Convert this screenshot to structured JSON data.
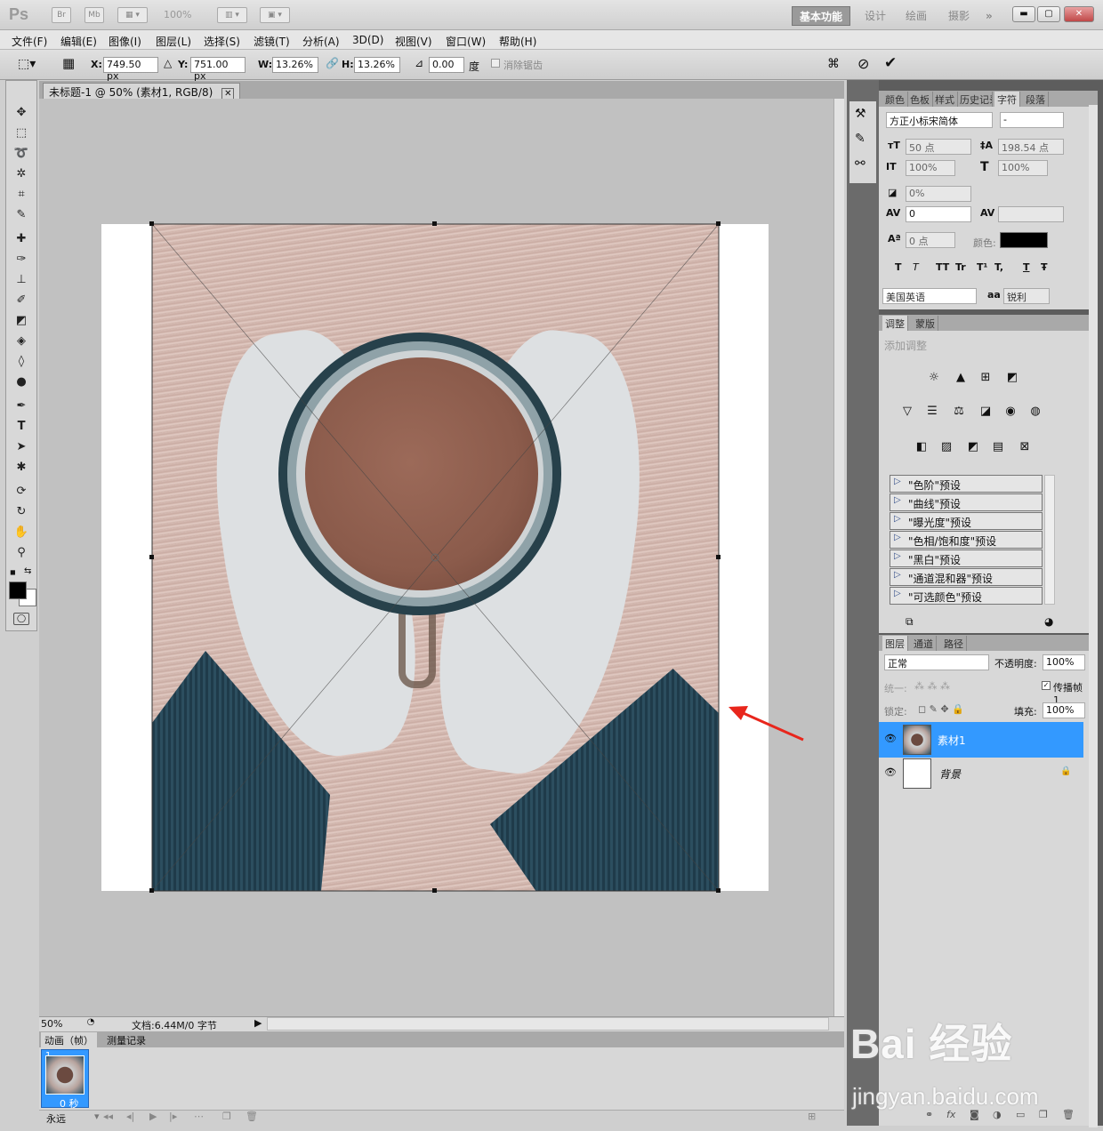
{
  "app": {
    "logo": "Ps",
    "quick_buttons": [
      "Br",
      "Mb",
      "100%"
    ],
    "workspaces": [
      "基本功能",
      "设计",
      "绘画",
      "摄影"
    ],
    "more": "»"
  },
  "menu": [
    "文件(F)",
    "编辑(E)",
    "图像(I)",
    "图层(L)",
    "选择(S)",
    "滤镜(T)",
    "分析(A)",
    "3D(D)",
    "视图(V)",
    "窗口(W)",
    "帮助(H)"
  ],
  "options": {
    "x_label": "X:",
    "x_value": "749.50 px",
    "y_label": "Y:",
    "y_value": "751.00 px",
    "w_label": "W:",
    "w_value": "13.26%",
    "h_label": "H:",
    "h_value": "13.26%",
    "angle_value": "0.00",
    "angle_unit": "度",
    "antialias_label": "消除锯齿"
  },
  "document": {
    "tab_title": "未标题-1 @ 50% (素材1, RGB/8)",
    "zoom": "50%",
    "doc_info": "文档:6.44M/0 字节"
  },
  "animation": {
    "tabs": [
      "动画（帧）",
      "测量记录"
    ],
    "frame_number": "1",
    "frame_delay": "0 秒",
    "loop": "永远"
  },
  "character_panel": {
    "tabs": [
      "颜色",
      "色板",
      "样式",
      "历史记录",
      "字符",
      "段落"
    ],
    "font_family": "方正小标宋简体",
    "font_style": "-",
    "font_size": "50 点",
    "leading": "198.54 点",
    "vertical_scale": "100%",
    "horizontal_scale": "100%",
    "tracking_ratio": "0%",
    "kerning": "0",
    "baseline": "0 点",
    "color_label": "颜色:",
    "style_buttons": [
      "T",
      "T",
      "TT",
      "Tr",
      "T¹",
      "T,",
      "T",
      "Ŧ"
    ],
    "language": "美国英语",
    "aa_label": "aa",
    "antialias": "锐利"
  },
  "adjustments_panel": {
    "tabs": [
      "调整",
      "蒙版"
    ],
    "hint": "添加调整",
    "presets": [
      "\"色阶\"预设",
      "\"曲线\"预设",
      "\"曝光度\"预设",
      "\"色相/饱和度\"预设",
      "\"黑白\"预设",
      "\"通道混和器\"预设",
      "\"可选颜色\"预设"
    ]
  },
  "layers_panel": {
    "tabs": [
      "图层",
      "通道",
      "路径"
    ],
    "blend_mode": "正常",
    "opacity_label": "不透明度:",
    "opacity": "100%",
    "unify_label": "统一:",
    "propagate_label": "传播帧 1",
    "lock_label": "锁定:",
    "fill_label": "填充:",
    "fill": "100%",
    "layers": [
      {
        "name": "素材1",
        "selected": true
      },
      {
        "name": "背景",
        "selected": false
      }
    ]
  },
  "watermark": {
    "brand": "Bai 经验",
    "url": "jingyan.baidu.com"
  },
  "colors": {
    "selection_blue": "#3399ff",
    "arrow_red": "#e8261c",
    "foreground": "#000000",
    "background": "#ffffff"
  }
}
